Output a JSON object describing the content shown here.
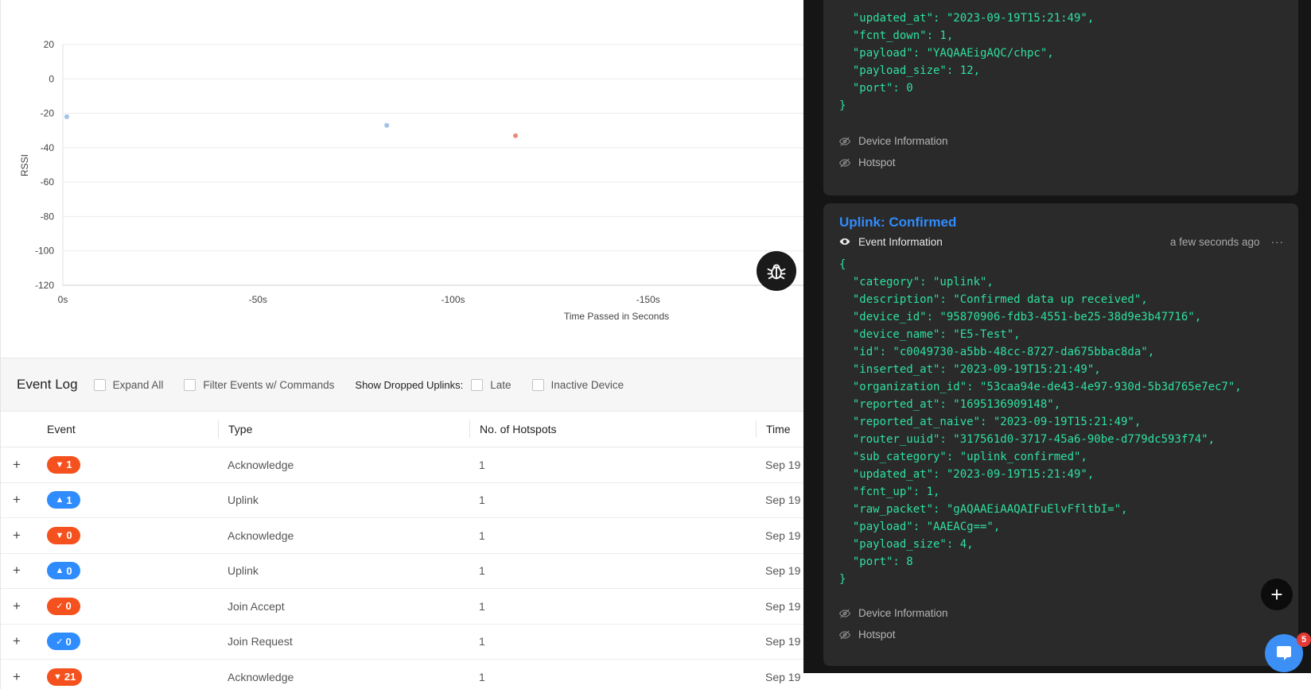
{
  "chart_data": {
    "type": "scatter",
    "xlabel": "Time Passed in Seconds",
    "ylabel": "RSSI",
    "x_ticks": [
      "0s",
      "-50s",
      "-100s",
      "-150s"
    ],
    "y_ticks": [
      "20",
      "0",
      "-20",
      "-40",
      "-60",
      "-80",
      "-100",
      "-120"
    ],
    "xlim": [
      0,
      -190
    ],
    "ylim": [
      -120,
      20
    ],
    "series": [
      {
        "color": "#9fc3e6",
        "points": [
          {
            "x": -1,
            "y": -22
          },
          {
            "x": -83,
            "y": -27
          }
        ]
      },
      {
        "color": "#ec8a7a",
        "points": [
          {
            "x": -116,
            "y": -33
          }
        ]
      }
    ]
  },
  "debug_icon": "bug-icon",
  "event_log": {
    "title": "Event Log",
    "expand_all": "Expand All",
    "filter_commands": "Filter Events w/ Commands",
    "show_dropped_label": "Show Dropped Uplinks:",
    "late": "Late",
    "inactive_device": "Inactive Device"
  },
  "table": {
    "headers": {
      "event": "Event",
      "type": "Type",
      "hotspots": "No. of Hotspots",
      "time": "Time"
    },
    "rows": [
      {
        "expand": "+",
        "badge_glyph": "▼",
        "badge_num": "1",
        "badge_color": "#f4511e",
        "type": "Acknowledge",
        "hotspots": "1",
        "time": "Sep 19"
      },
      {
        "expand": "+",
        "badge_glyph": "▲",
        "badge_num": "1",
        "badge_color": "#2f8cff",
        "type": "Uplink",
        "hotspots": "1",
        "time": "Sep 19"
      },
      {
        "expand": "+",
        "badge_glyph": "▼",
        "badge_num": "0",
        "badge_color": "#f4511e",
        "type": "Acknowledge",
        "hotspots": "1",
        "time": "Sep 19"
      },
      {
        "expand": "+",
        "badge_glyph": "▲",
        "badge_num": "0",
        "badge_color": "#2f8cff",
        "type": "Uplink",
        "hotspots": "1",
        "time": "Sep 19"
      },
      {
        "expand": "+",
        "badge_glyph": "✓",
        "badge_num": "0",
        "badge_color": "#f4511e",
        "type": "Join Accept",
        "hotspots": "1",
        "time": "Sep 19"
      },
      {
        "expand": "+",
        "badge_glyph": "✓",
        "badge_num": "0",
        "badge_color": "#2f8cff",
        "type": "Join Request",
        "hotspots": "1",
        "time": "Sep 19"
      },
      {
        "expand": "+",
        "badge_glyph": "▼",
        "badge_num": "21",
        "badge_color": "#f4511e",
        "type": "Acknowledge",
        "hotspots": "1",
        "time": "Sep 19"
      }
    ]
  },
  "card_top": {
    "json": "  \"updated_at\": \"2023-09-19T15:21:49\",\n  \"fcnt_down\": 1,\n  \"payload\": \"YAQAAEigAQC/chpc\",\n  \"payload_size\": 12,\n  \"port\": 0\n}",
    "device_info": "Device Information",
    "hotspot": "Hotspot"
  },
  "card_main": {
    "title": "Uplink: Confirmed",
    "event_info": "Event Information",
    "timestamp": "a few seconds ago",
    "more": "···",
    "json": "{\n  \"category\": \"uplink\",\n  \"description\": \"Confirmed data up received\",\n  \"device_id\": \"95870906-fdb3-4551-be25-38d9e3b47716\",\n  \"device_name\": \"E5-Test\",\n  \"id\": \"c0049730-a5bb-48cc-8727-da675bbac8da\",\n  \"inserted_at\": \"2023-09-19T15:21:49\",\n  \"organization_id\": \"53caa94e-de43-4e97-930d-5b3d765e7ec7\",\n  \"reported_at\": \"1695136909148\",\n  \"reported_at_naive\": \"2023-09-19T15:21:49\",\n  \"router_uuid\": \"317561d0-3717-45a6-90be-d779dc593f74\",\n  \"sub_category\": \"uplink_confirmed\",\n  \"updated_at\": \"2023-09-19T15:21:49\",\n  \"fcnt_up\": 1,\n  \"raw_packet\": \"gAQAAEiAAQAIFuElvFfltbI=\",\n  \"payload\": \"AAEACg==\",\n  \"payload_size\": 4,\n  \"port\": 8\n}",
    "device_info": "Device Information",
    "hotspot": "Hotspot"
  },
  "fab_add": "+",
  "chat_badge": "5"
}
